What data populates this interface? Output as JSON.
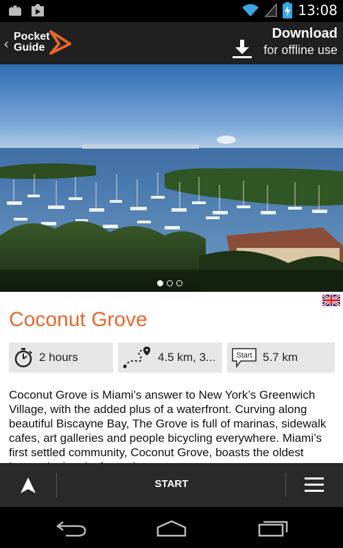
{
  "status_bar": {
    "time": "13:08",
    "icons": [
      "android-icon",
      "play-store-icon",
      "wifi-icon",
      "signal-icon",
      "battery-charging-icon"
    ]
  },
  "header": {
    "logo_line1": "Pocket",
    "logo_line2": "Guide",
    "download_title": "Download",
    "download_subtitle": "for offline use"
  },
  "gallery": {
    "page_count": 3,
    "current_page": 1
  },
  "tour": {
    "language_flag": "uk-flag-icon",
    "title": "Coconut Grove",
    "duration": "2 hours",
    "distance": "4.5 km, 3...",
    "start_distance": "5.7 km",
    "start_badge": "Start",
    "description": "Coconut Grove is Miami’s answer to New York’s Greenwich Village, with the added plus of a waterfront. Curving along beautiful Biscayne Bay, The Grove is full of marinas, sidewalk cafes, art galleries and people bicycling everywhere. Miami’s first settled community, Coconut Grove, boasts the oldest homes in the city from pioneer"
  },
  "bottom_bar": {
    "start_label": "START"
  },
  "colors": {
    "accent": "#e8662a",
    "stat_bg": "#e6e6e6",
    "appbar_bg": "#202020"
  }
}
